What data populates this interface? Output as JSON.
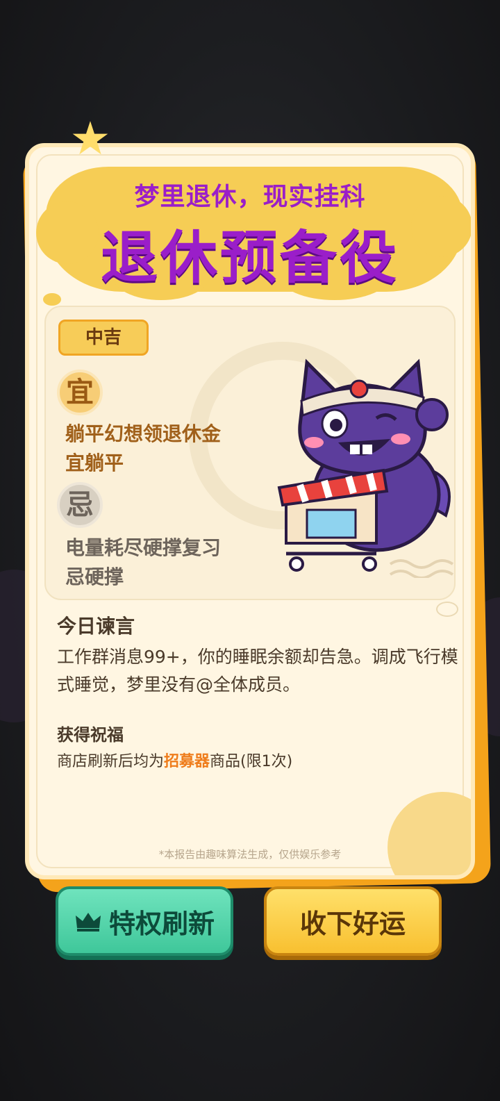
{
  "card": {
    "subtitle": "梦里退休，现实挂科",
    "title": "退休预备役",
    "level": "中吉",
    "yi_symbol": "宜",
    "yi_lines": [
      "躺平幻想领退休金",
      "宜躺平"
    ],
    "ji_symbol": "忌",
    "ji_lines": [
      "电量耗尽硬撑复习",
      "忌硬撑"
    ],
    "advice_title": "今日谏言",
    "advice_text": "工作群消息99+，你的睡眠余额却告急。调成飞行模式睡觉，梦里没有@全体成员。",
    "blessing_title": "获得祝福",
    "blessing_prefix": "商店刷新后均为",
    "blessing_highlight": "招募器",
    "blessing_suffix": "商品(限1次)",
    "disclaimer": "*本报告由趣味算法生成，仅供娱乐参考"
  },
  "buttons": {
    "refresh_label": "特权刷新",
    "accept_label": "收下好运"
  },
  "colors": {
    "title_purple": "#9a1ec9",
    "cloud_yellow": "#f6cd55",
    "card_orange": "#f4a31b",
    "teal_button": "#3fc79a",
    "yellow_button": "#f8c030"
  },
  "icons": [
    "star-icon",
    "crown-icon",
    "cat-mascot-illustration",
    "bagua-decoration-icon"
  ]
}
